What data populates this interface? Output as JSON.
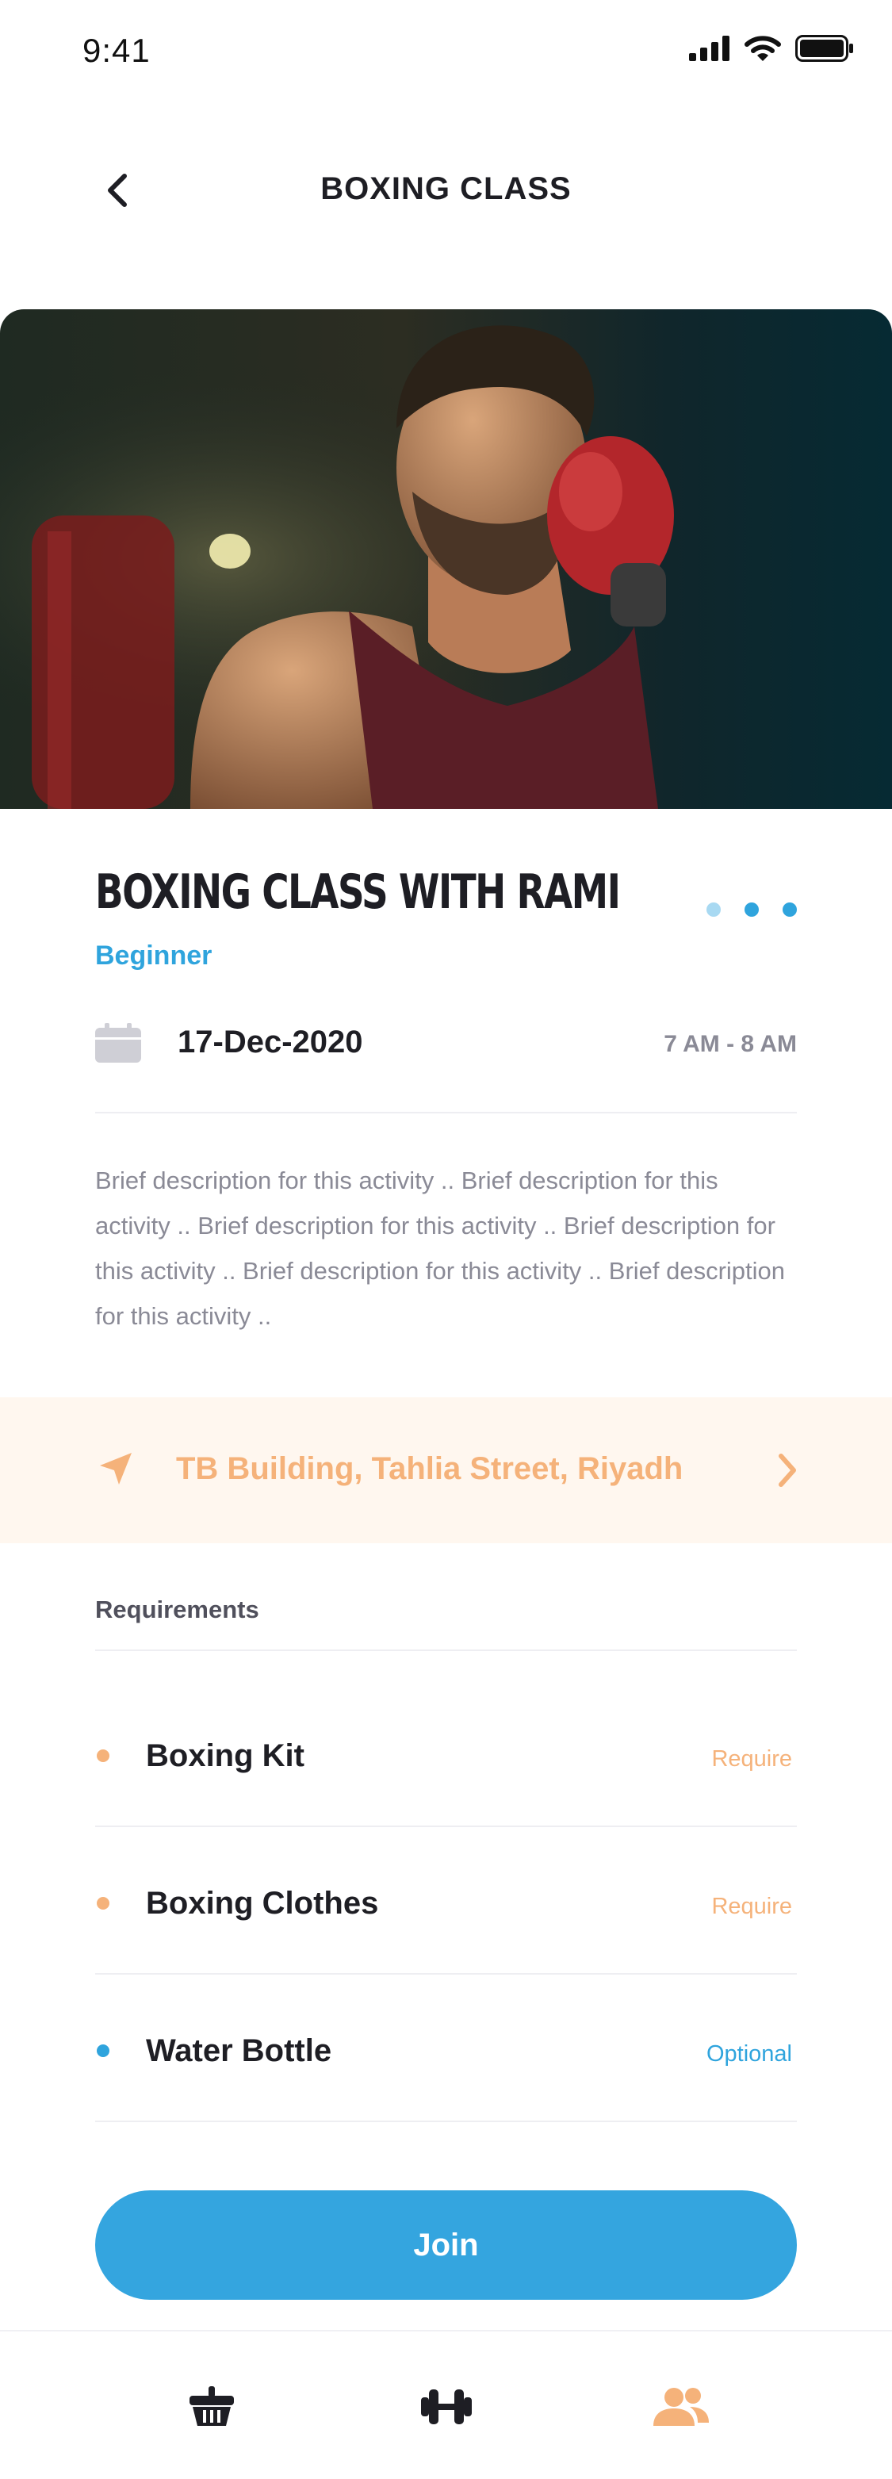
{
  "status_bar": {
    "time": "9:41"
  },
  "nav": {
    "title": "BOXING CLASS"
  },
  "hero": {
    "alt": "boxer with red glove"
  },
  "activity": {
    "title": "BOXING CLASS WITH RAMI",
    "level": "Beginner",
    "date": "17-Dec-2020",
    "time": "7 AM - 8 AM",
    "description": "Brief description for this activity .. Brief description for this activity .. Brief description for this activity .. Brief description for this activity .. Brief description for this activity .. Brief description for this activity ..",
    "carousel": {
      "count": 3,
      "active_index": 0
    }
  },
  "location": {
    "address": "TB Building, Tahlia Street, Riyadh"
  },
  "requirements": {
    "title": "Requirements",
    "items": [
      {
        "name": "Boxing Kit",
        "tag": "Require",
        "color": "#f5b27a"
      },
      {
        "name": "Boxing Clothes",
        "tag": "Require",
        "color": "#f5b27a"
      },
      {
        "name": "Water Bottle",
        "tag": "Optional",
        "color": "#2fa4dd"
      }
    ]
  },
  "actions": {
    "join_label": "Join"
  },
  "tabbar": {
    "tabs": [
      {
        "icon": "basket-icon",
        "active": false
      },
      {
        "icon": "dumbbell-icon",
        "active": false
      },
      {
        "icon": "people-icon",
        "active": true
      }
    ],
    "active_color": "#f5b27a",
    "inactive_color": "#1e1e24"
  },
  "colors": {
    "accent": "#34a5df",
    "warm": "#f5b27a",
    "warm_bg": "#fff7ef"
  }
}
